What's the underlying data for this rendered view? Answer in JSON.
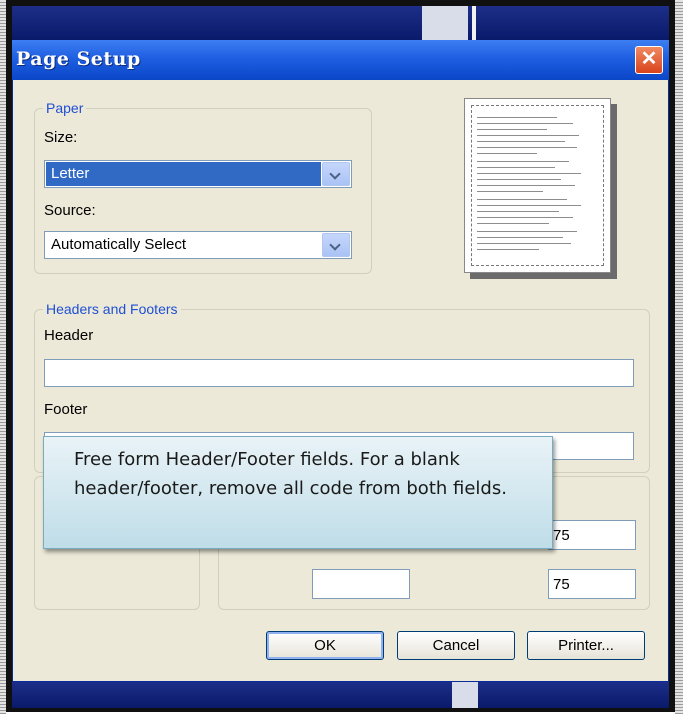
{
  "dialog": {
    "title": "Page Setup",
    "close_glyph": "✕"
  },
  "paper": {
    "legend": "Paper",
    "size_label": "Size:",
    "size_value": "Letter",
    "source_label": "Source:",
    "source_value": "Automatically Select"
  },
  "headers_footers": {
    "legend": "Headers and Footers",
    "header_label": "Header",
    "header_value": "",
    "footer_label": "Footer",
    "footer_value": ""
  },
  "margins": {
    "value_1": "75",
    "value_2": "75"
  },
  "callout": {
    "text": "Free form Header/Footer fields.  For a blank header/footer, remove all code from both fields."
  },
  "buttons": {
    "ok": "OK",
    "cancel": "Cancel",
    "printer": "Printer..."
  },
  "icons": [
    "close-icon",
    "chevron-down-icon",
    "page-preview-icon"
  ],
  "colors": {
    "titlebar": "#1f5fe2",
    "dialog_bg": "#ece9d8",
    "legend_text": "#1f4fd4",
    "selection": "#316ac5",
    "close_button": "#d8431c"
  }
}
